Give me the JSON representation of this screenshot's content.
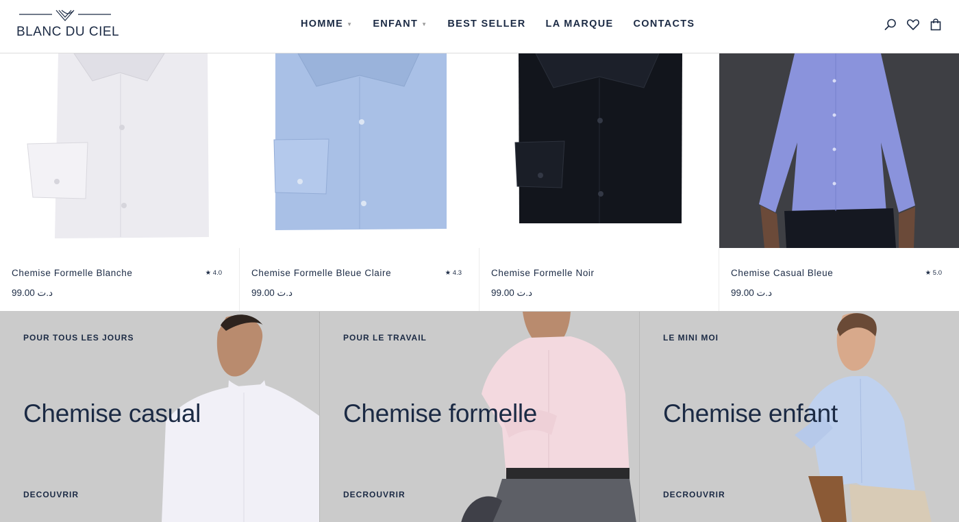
{
  "brand": {
    "name": "BLANC DU CIEL",
    "color": "#1b2a44"
  },
  "nav": {
    "items": [
      {
        "label": "HOMME",
        "has_dropdown": true
      },
      {
        "label": "ENFANT",
        "has_dropdown": true
      },
      {
        "label": "BEST SELLER",
        "has_dropdown": false
      },
      {
        "label": "LA MARQUE",
        "has_dropdown": false
      },
      {
        "label": "CONTACTS",
        "has_dropdown": false
      }
    ],
    "icons": [
      "search-icon",
      "heart-icon",
      "bag-icon"
    ]
  },
  "products": [
    {
      "name": "Chemise Formelle Blanche",
      "rating": "★ 4.0",
      "price": "د.ت 99.00",
      "shirt_color": "#ecebf0"
    },
    {
      "name": "Chemise Formelle Bleue Claire",
      "rating": "★ 4.3",
      "price": "د.ت 99.00",
      "shirt_color": "#a9c0e6"
    },
    {
      "name": "Chemise Formelle Noir",
      "rating": "",
      "price": "د.ت 99.00",
      "shirt_color": "#12151c"
    },
    {
      "name": "Chemise Casual Bleue",
      "rating": "★ 5.0",
      "price": "د.ت 99.00",
      "shirt_color": "#8a93dc"
    }
  ],
  "banners": [
    {
      "kicker": "POUR TOUS LES JOURS",
      "title": "Chemise casual",
      "cta": "DECOUVRIR"
    },
    {
      "kicker": "POUR LE TRAVAIL",
      "title": "Chemise formelle",
      "cta": "DECROUVRIR"
    },
    {
      "kicker": "LE MINI MOI",
      "title": "Chemise enfant",
      "cta": "DECROUVRIR"
    }
  ]
}
